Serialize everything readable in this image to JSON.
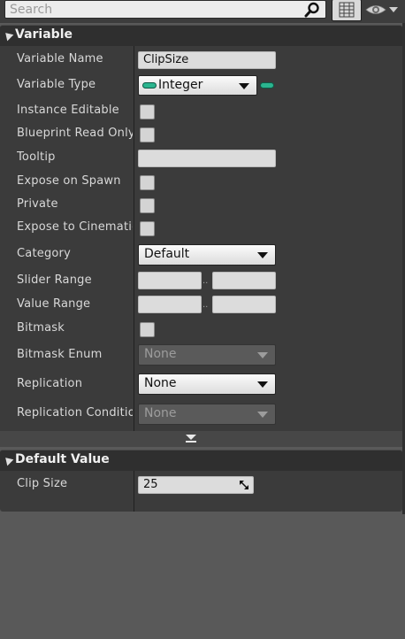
{
  "search": {
    "placeholder": "Search"
  },
  "icons": {
    "search": "search-icon",
    "view": "grid-list-icon",
    "visibility": "eye-icon",
    "expand": "chevron-down-icon",
    "resize": "resize-arrows-icon"
  },
  "colors": {
    "pin_integer": "#2bb58f",
    "panel_bg": "#3b3b3b",
    "header_bg": "#2f2f2f",
    "background": "#595959"
  },
  "variable_section": {
    "title": "Variable",
    "variable_name_label": "Variable Name",
    "variable_name_value": "ClipSize",
    "variable_type_label": "Variable Type",
    "variable_type_value": "Integer",
    "instance_editable_label": "Instance Editable",
    "blueprint_read_only_label": "Blueprint Read Only",
    "tooltip_label": "Tooltip",
    "tooltip_value": "",
    "expose_on_spawn_label": "Expose on Spawn",
    "private_label": "Private",
    "expose_to_cinematics_label": "Expose to Cinematics",
    "category_label": "Category",
    "category_value": "Default",
    "slider_range_label": "Slider Range",
    "value_range_label": "Value Range",
    "range_separator": "..",
    "bitmask_label": "Bitmask",
    "bitmask_enum_label": "Bitmask Enum",
    "bitmask_enum_value": "None",
    "replication_label": "Replication",
    "replication_value": "None",
    "replication_condition_label": "Replication Condition",
    "replication_condition_value": "None"
  },
  "default_value_section": {
    "title": "Default Value",
    "clip_size_label": "Clip Size",
    "clip_size_value": "25"
  }
}
